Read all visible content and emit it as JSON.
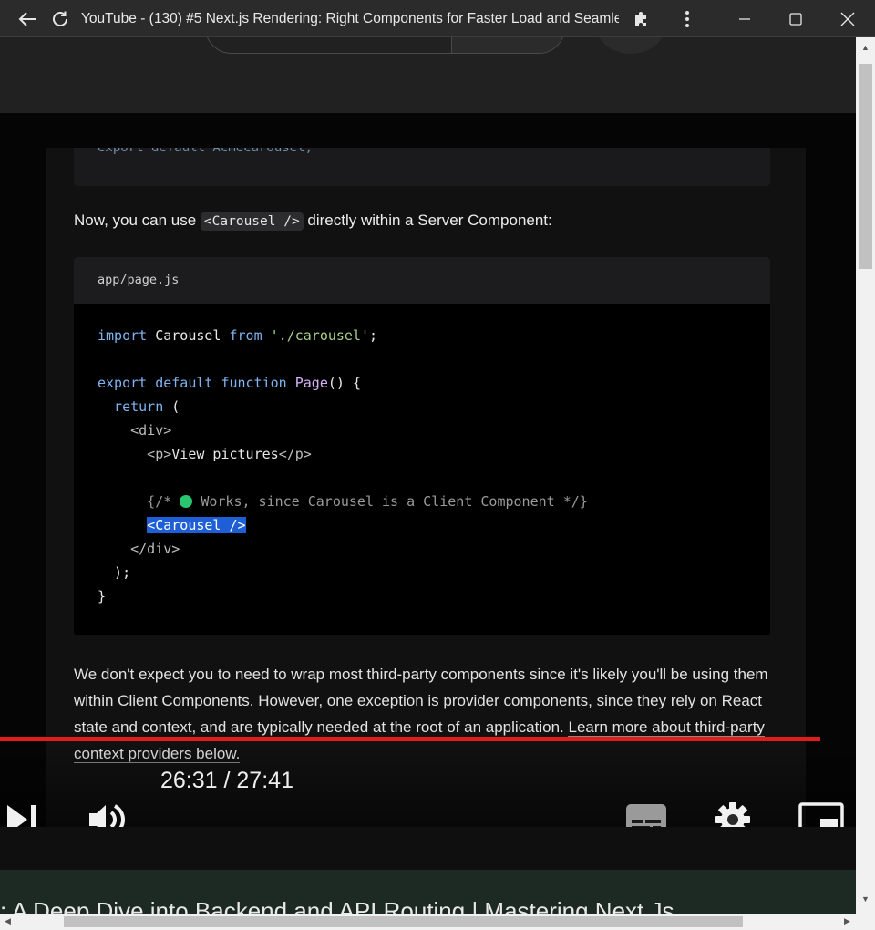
{
  "window": {
    "title": "YouTube - (130) #5 Next.js Rendering: Right Components for Faster Load and Seamles..."
  },
  "icons": {
    "back": "back-arrow-icon",
    "reload": "reload-icon",
    "extensions": "puzzle-icon",
    "menu": "kebab-menu-icon",
    "minimize": "minimize-icon",
    "maximize": "maximize-icon",
    "close": "close-icon"
  },
  "video": {
    "doc_top_code": "export default AcmeCarousel;",
    "intro_before": "Now, you can use ",
    "intro_code": "<Carousel />",
    "intro_after": " directly within a Server Component:",
    "file_name": "app/page.js",
    "code": {
      "l1_import": "import",
      "l1_name": " Carousel ",
      "l1_from": "from",
      "l1_str": " './carousel'",
      "l1_end": ";",
      "l3_export": "export default function",
      "l3_fn": " Page",
      "l3_end": "() {",
      "l4_return": "  return",
      "l4_end": " (",
      "l5": "    <div>",
      "l6_open": "      <p>",
      "l6_text": "View pictures",
      "l6_close": "</p>",
      "l8_open": "      {/* ",
      "l8_text": " Works, since Carousel is a Client Component */}",
      "l9_indent": "      ",
      "l9_sel": "<Carousel />",
      "l10": "    </div>",
      "l11": "  );",
      "l12": "}"
    },
    "paragraph": "We don't expect you to need to wrap most third-party components since it's likely you'll be using them within Client Components. However, one exception is provider components, since they rely on React state and context, and are typically needed at the root of an application.",
    "paragraph_link": "Learn more about third-party context providers below."
  },
  "player": {
    "current_time": "26:31",
    "separator": " / ",
    "duration": "27:41",
    "progress_fraction": 0.958,
    "accent_color": "#e21b1b"
  },
  "recommendation": {
    "title": ": A Deep Dive into Backend and API Routing | Mastering Next.Js"
  }
}
